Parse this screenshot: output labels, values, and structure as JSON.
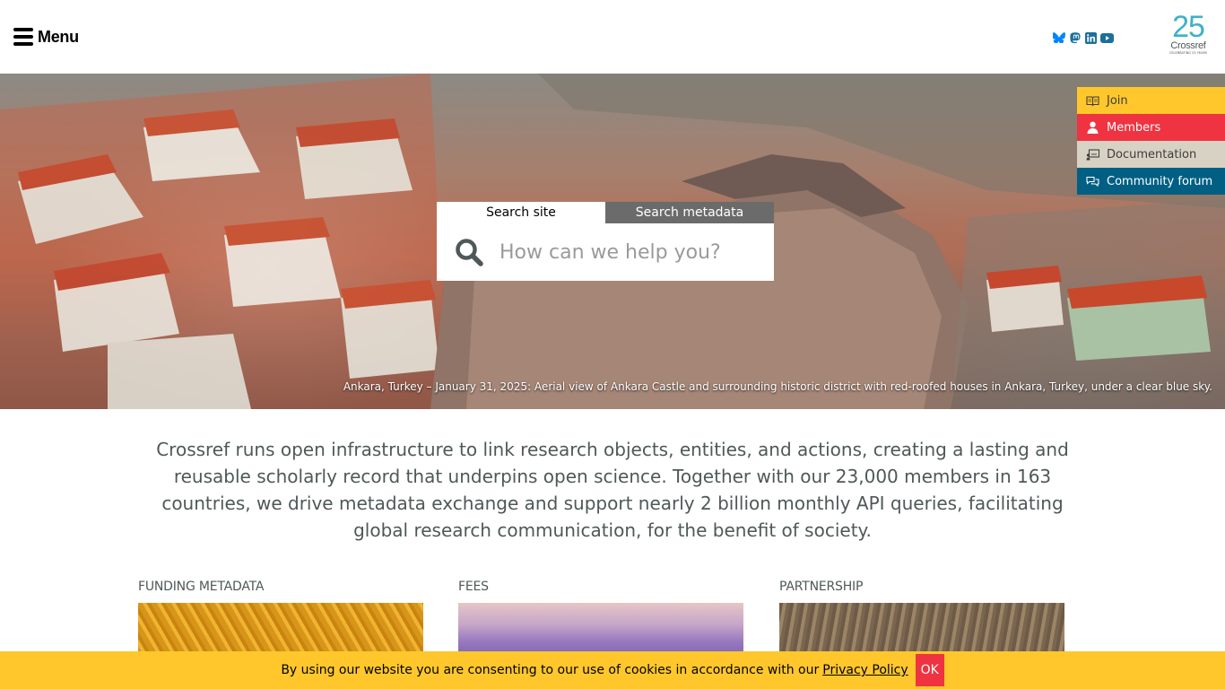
{
  "header": {
    "menu_label": "Menu",
    "socials": [
      {
        "icon": "bluesky-icon"
      },
      {
        "icon": "mastodon-icon"
      },
      {
        "icon": "linkedin-icon"
      },
      {
        "icon": "youtube-icon"
      }
    ],
    "logo": {
      "number": "25",
      "brand": "Crossref",
      "tagline": "CELEBRATING 25 YEARS"
    }
  },
  "hero": {
    "caption": "Ankara, Turkey – January 31, 2025: Aerial view of Ankara Castle and surrounding historic district with red-roofed houses in Ankara, Turkey, under a clear blue sky."
  },
  "search": {
    "tab_site": "Search site",
    "tab_metadata": "Search metadata",
    "placeholder": "How can we help you?"
  },
  "quick_links": [
    {
      "label": "Join",
      "icon": "book-icon",
      "color": "#ffc72c"
    },
    {
      "label": "Members",
      "icon": "user-icon",
      "color": "#ef3340"
    },
    {
      "label": "Documentation",
      "icon": "presentation-icon",
      "color": "#d8d2c4"
    },
    {
      "label": "Community forum",
      "icon": "chat-icon",
      "color": "#005f83"
    }
  ],
  "intro": {
    "text": "Crossref runs open infrastructure to link research objects, entities, and actions, creating a lasting and reusable scholarly record that underpins open science. Together with our 23,000 members in 163 countries, we drive metadata exchange and support nearly 2 billion monthly API queries, facilitating global research communication, for the benefit of society."
  },
  "cards": [
    {
      "category": "FUNDING METADATA"
    },
    {
      "category": "FEES"
    },
    {
      "category": "PARTNERSHIP"
    }
  ],
  "cookie": {
    "text": "By using our website you are consenting to our use of cookies in accordance with our",
    "link": "Privacy Policy",
    "ok": "OK"
  },
  "colors": {
    "accent_teal": "#3eb1c8",
    "yellow": "#ffc72c",
    "red": "#ef3340",
    "sand": "#d8d2c4",
    "dark_blue": "#005f83"
  }
}
